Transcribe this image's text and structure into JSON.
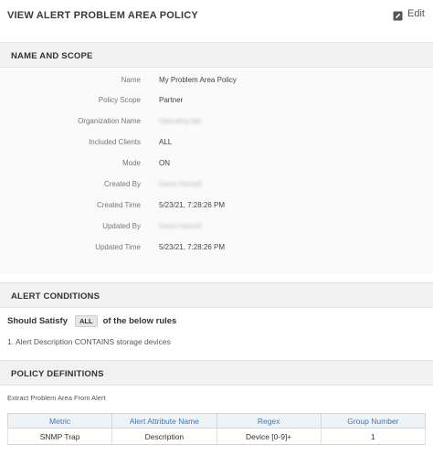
{
  "header": {
    "title": "VIEW ALERT PROBLEM AREA POLICY",
    "edit_label": "Edit"
  },
  "sections": {
    "name_scope": "NAME AND SCOPE",
    "alert_conditions": "ALERT CONDITIONS",
    "policy_definitions": "POLICY DEFINITIONS"
  },
  "details": [
    {
      "key": "Name",
      "value": "My Problem Area Policy"
    },
    {
      "key": "Policy Scope",
      "value": "Partner"
    },
    {
      "key": "Organization Name",
      "value": "Opsramp-lab"
    },
    {
      "key": "Included Clients",
      "value": "ALL"
    },
    {
      "key": "Mode",
      "value": "ON"
    },
    {
      "key": "Created By",
      "value": "Gene Harsell"
    },
    {
      "key": "Created Time",
      "value": "5/23/21, 7:28:26 PM"
    },
    {
      "key": "Updated By",
      "value": "Gene Harsell"
    },
    {
      "key": "Updated Time",
      "value": "5/23/21, 7:28:26 PM"
    }
  ],
  "conditions": {
    "should_satisfy": "Should Satisfy",
    "match_badge": "ALL",
    "suffix": "of the below rules",
    "rules": [
      "1. Alert Description CONTAINS storage devices"
    ]
  },
  "definitions": {
    "extract_label": "Extract Problem Area From Alert",
    "columns": [
      "Metric",
      "Alert Attribute Name",
      "Regex",
      "Group Number"
    ],
    "rows": [
      [
        "SNMP Trap",
        "Description",
        "Device [0-9]+",
        "1"
      ]
    ]
  }
}
